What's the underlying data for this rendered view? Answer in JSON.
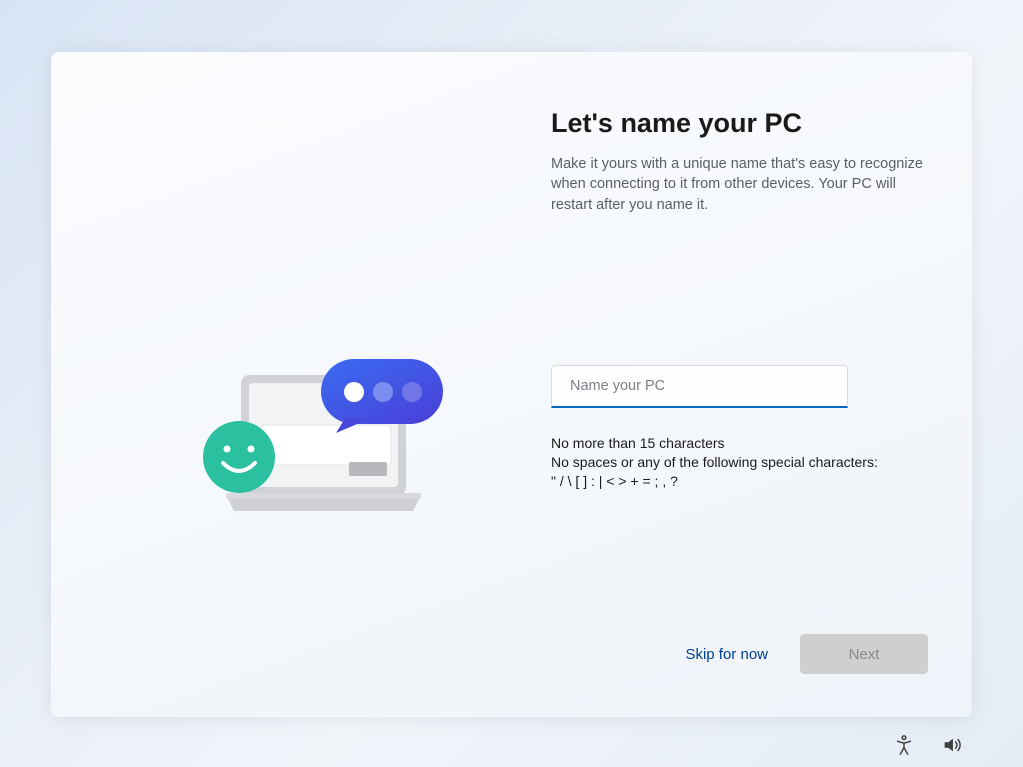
{
  "main": {
    "title": "Let's name your PC",
    "description": "Make it yours with a unique name that's easy to recognize when connecting to it from other devices. Your PC will restart after you name it.",
    "input_placeholder": "Name your PC",
    "input_value": "",
    "rule_line1": "No more than 15 characters",
    "rule_line2": "No spaces or any of the following special characters:",
    "rule_line3": "\" / \\ [ ] : | < > + = ; , ?"
  },
  "buttons": {
    "skip_label": "Skip for now",
    "next_label": "Next"
  },
  "icons": {
    "accessibility": "accessibility-icon",
    "volume": "volume-icon"
  }
}
